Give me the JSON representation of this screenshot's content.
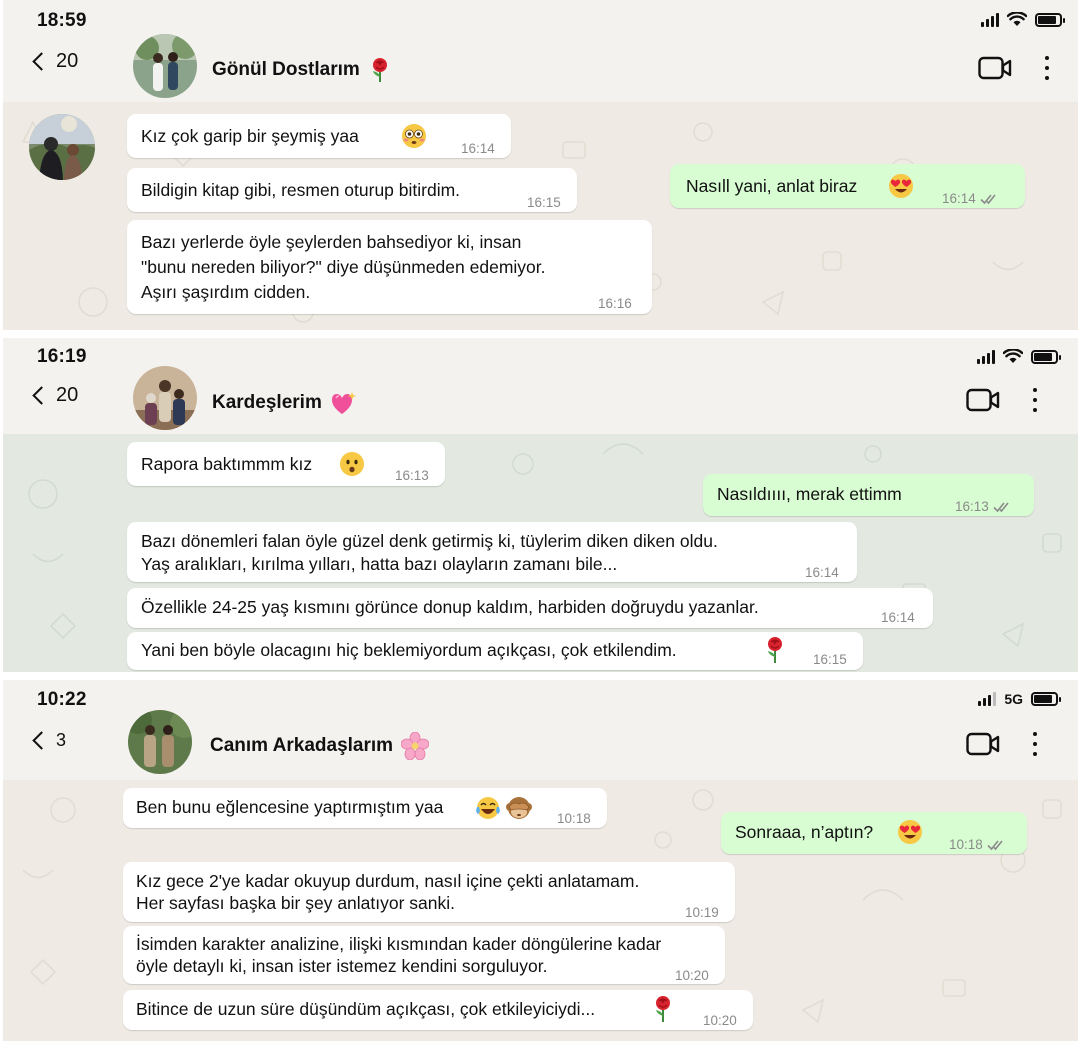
{
  "colors": {
    "incoming_bubble": "#ffffff",
    "outgoing_bubble": "#d9fdd3",
    "header_bg": "#f4f2ef",
    "chat_bg_1": "#efebe4",
    "chat_bg_2": "#e3e9e1",
    "chat_bg_3": "#efebe4",
    "read_ticks": "#8a8a8a"
  },
  "panels": [
    {
      "status_time": "18:59",
      "network": "wifi",
      "back_count": "20",
      "group_name": "Gönül Dostlarım",
      "group_emoji": "rose-icon",
      "messages": [
        {
          "dir": "in",
          "text": "Kız çok garip bir şeymiş yaa",
          "emoji": "flushed-face-icon",
          "time": "16:14"
        },
        {
          "dir": "in",
          "text": "Bildigin kitap gibi, resmen oturup bitirdim.",
          "time": "16:15"
        },
        {
          "dir": "in",
          "lines": [
            "Bazı yerlerde öyle şeylerden bahsediyor ki, insan",
            "\"bunu nereden biliyor?\" diye düşünmeden edemiyor.",
            "Aşırı şaşırdım cidden."
          ],
          "time": "16:16"
        },
        {
          "dir": "out",
          "text": "Nasıll yani, anlat biraz",
          "emoji": "heart-eyes-icon",
          "time": "16:14",
          "read": true
        }
      ]
    },
    {
      "status_time": "16:19",
      "network": "wifi",
      "back_count": "20",
      "group_name": "Kardeşlerim",
      "group_emoji": "sparkling-heart-icon",
      "messages": [
        {
          "dir": "in",
          "text": "Rapora baktımmm kız",
          "emoji": "hushed-face-icon",
          "time": "16:13"
        },
        {
          "dir": "out",
          "text": "Nasıldıııı, merak ettimm",
          "time": "16:13",
          "read": true
        },
        {
          "dir": "in",
          "lines": [
            "Bazı dönemleri falan öyle güzel denk getirmiş ki, tüylerim diken diken oldu.",
            "Yaş aralıkları, kırılma yılları, hatta bazı olayların zamanı bile..."
          ],
          "time": "16:14"
        },
        {
          "dir": "in",
          "text": "Özellikle 24-25 yaş kısmını görünce donup kaldım, harbiden doğruydu yazanlar.",
          "time": "16:14"
        },
        {
          "dir": "in",
          "text": "Yani ben böyle olacagını hiç beklemiyordum açıkçası, çok etkilendim.",
          "emoji": "rose-icon",
          "time": "16:15"
        }
      ]
    },
    {
      "status_time": "10:22",
      "network": "5G",
      "back_count": "3",
      "group_name": "Canım Arkadaşlarım",
      "group_emoji": "cherry-blossom-icon",
      "messages": [
        {
          "dir": "in",
          "text": "Ben bunu eğlencesine yaptırmıştım yaa",
          "emoji": "tears-of-joy-icon",
          "emoji2": "see-no-evil-monkey-icon",
          "time": "10:18"
        },
        {
          "dir": "out",
          "text": "Sonraaa, n’aptın?",
          "emoji": "heart-eyes-icon",
          "time": "10:18",
          "read": true
        },
        {
          "dir": "in",
          "lines": [
            "Kız gece 2'ye kadar okuyup durdum, nasıl içine çekti anlatamam.",
            "Her sayfası başka bir şey anlatıyor sanki."
          ],
          "time": "10:19"
        },
        {
          "dir": "in",
          "lines": [
            "İsimden karakter analizine, ilişki kısmından kader döngülerine kadar",
            "öyle detaylı ki, insan ister istemez kendini sorguluyor."
          ],
          "time": "10:20"
        },
        {
          "dir": "in",
          "text": "Bitince de uzun süre düşündüm açıkçası, çok etkileyiciydi...",
          "emoji": "rose-icon",
          "time": "10:20"
        }
      ]
    }
  ]
}
